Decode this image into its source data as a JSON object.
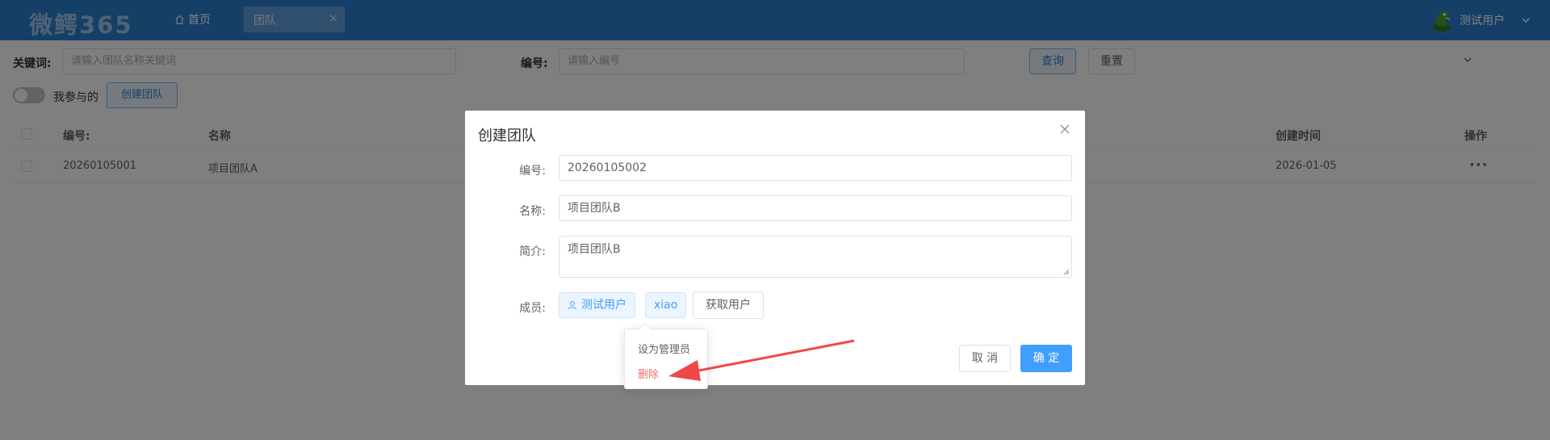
{
  "header": {
    "logo": "微鳄365",
    "home_label": "首页",
    "tab_label": "团队",
    "tab_close": "×",
    "user_name": "测试用户"
  },
  "search": {
    "keyword_label": "关键词:",
    "keyword_placeholder": "请输入团队名称关键词",
    "number_label": "编号:",
    "number_placeholder": "请输入编号",
    "query_label": "查询",
    "reset_label": "重置"
  },
  "toolbar": {
    "switch_label": "我参与的",
    "create_label": "创建团队"
  },
  "table": {
    "headers": {
      "number": "编号:",
      "name": "名称",
      "created": "创建时间",
      "ops": "操作"
    },
    "rows": [
      {
        "number": "20260105001",
        "name": "项目团队A",
        "created": "2026-01-05",
        "ops": "···"
      }
    ]
  },
  "dialog": {
    "title": "创建团队",
    "number_label": "编号:",
    "number_value": "20260105002",
    "name_label": "名称:",
    "name_value": "项目团队B",
    "intro_label": "简介:",
    "intro_value": "项目团队B",
    "members_label": "成员:",
    "members": [
      "测试用户",
      "xiao"
    ],
    "get_users_label": "获取用户",
    "cancel_label": "取 消",
    "confirm_label": "确 定"
  },
  "dropdown": {
    "items": [
      "设为管理员",
      "删除"
    ]
  },
  "colors": {
    "header_bg": "#2d7fd0",
    "primary": "#409eff",
    "danger": "#f56c6c",
    "annotation_arrow": "#f04848"
  }
}
